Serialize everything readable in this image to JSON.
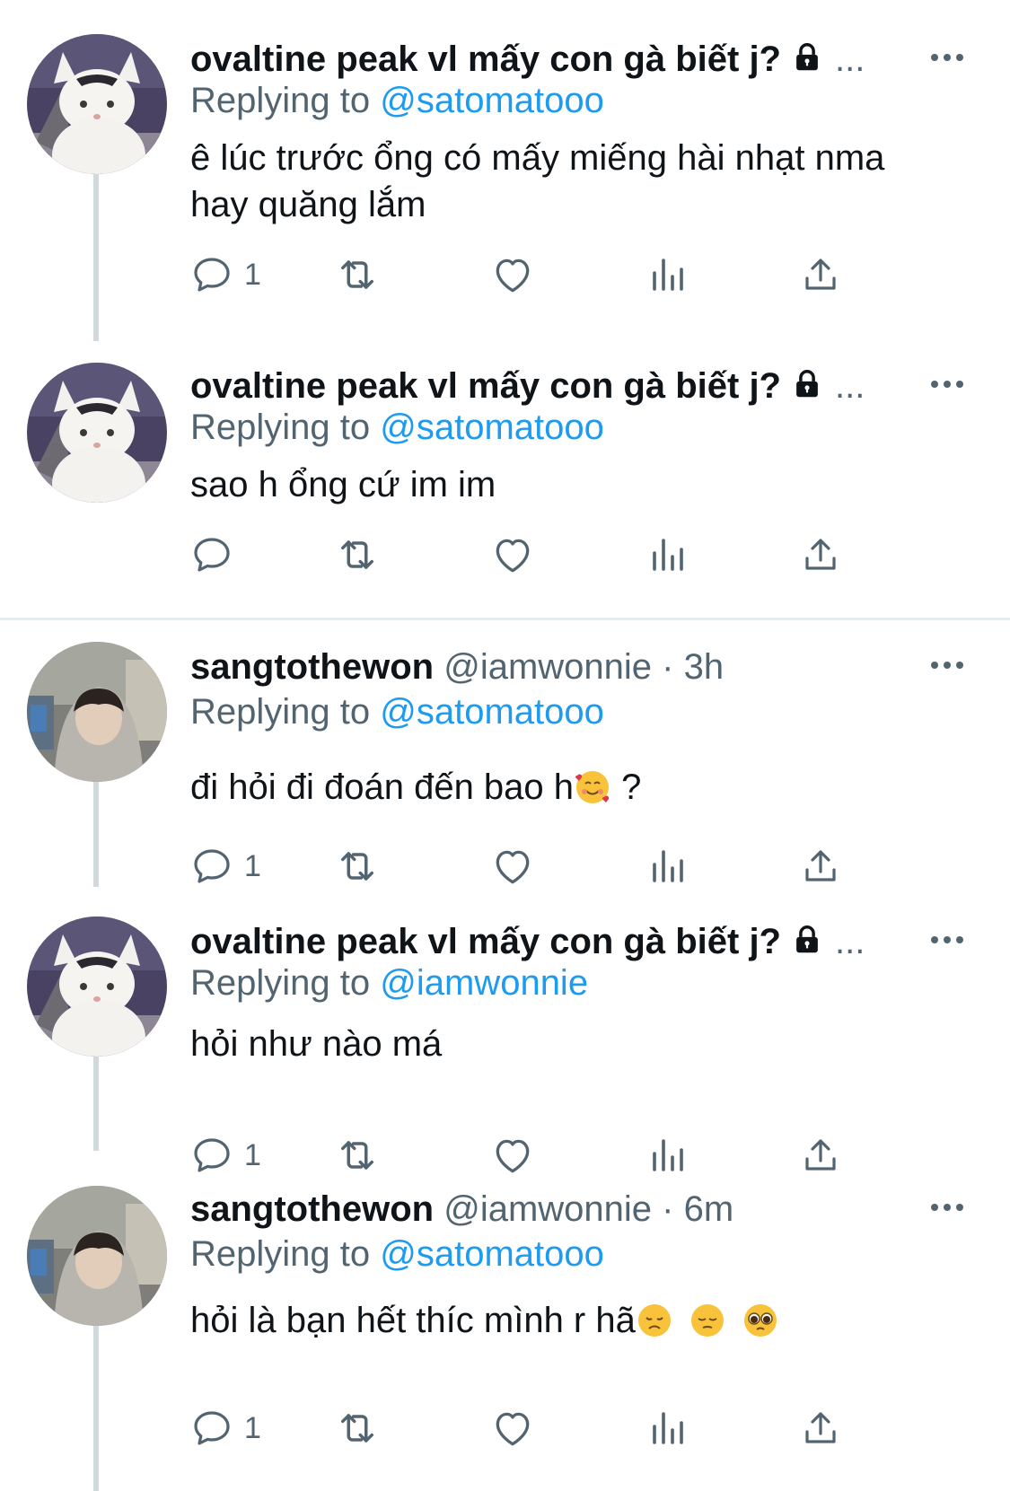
{
  "tweets": [
    {
      "author_name": "ovaltine peak vl mấy con gà biết j?",
      "author_handle": "",
      "time": "",
      "locked": true,
      "truncated": "...",
      "replying_prefix": "Replying to",
      "replying_to": "@satomatooo",
      "text_lines": [
        "ê lúc trước ổng có mấy miếng hài nhạt nma",
        "hay quăng lắm"
      ],
      "reply_count": "1",
      "avatar": "cat"
    },
    {
      "author_name": "ovaltine peak vl mấy con gà biết j?",
      "author_handle": "",
      "time": "",
      "locked": true,
      "truncated": "...",
      "replying_prefix": "Replying to",
      "replying_to": "@satomatooo",
      "text_lines": [
        "sao h ổng cứ im im"
      ],
      "reply_count": "",
      "avatar": "cat"
    },
    {
      "author_name": "sangtothewon",
      "author_handle": "@iamwonnie",
      "time": "3h",
      "separator": "·",
      "locked": false,
      "replying_prefix": "Replying to",
      "replying_to": "@satomatooo",
      "text_lines": [
        "đi hỏi đi đoán đến bao h"
      ],
      "text_suffix": " ?",
      "emojis": [
        "smiling-face-with-hearts-emoji"
      ],
      "reply_count": "1",
      "avatar": "person"
    },
    {
      "author_name": "ovaltine peak vl mấy con gà biết j?",
      "author_handle": "",
      "time": "",
      "locked": true,
      "truncated": "...",
      "replying_prefix": "Replying to",
      "replying_to": "@iamwonnie",
      "text_lines": [
        "hỏi như nào má"
      ],
      "reply_count": "1",
      "avatar": "cat"
    },
    {
      "author_name": "sangtothewon",
      "author_handle": "@iamwonnie",
      "time": "6m",
      "separator": "·",
      "locked": false,
      "replying_prefix": "Replying to",
      "replying_to": "@satomatooo",
      "text_lines": [
        "hỏi là bạn hết thíc mình r hã"
      ],
      "emojis": [
        "disappointed-face-emoji",
        "pensive-face-emoji",
        "pleading-face-emoji"
      ],
      "reply_count": "1",
      "avatar": "person"
    }
  ],
  "icons": {
    "reply": "reply-icon",
    "retweet": "retweet-icon",
    "like": "heart-icon",
    "views": "views-icon",
    "share": "share-icon",
    "more": "more-icon",
    "lock": "lock-icon"
  },
  "colors": {
    "accent": "#1d9bf0",
    "text": "#0f1419",
    "secondary": "#536471",
    "thread_line": "#cfd9de",
    "separator": "#e7ecef"
  }
}
